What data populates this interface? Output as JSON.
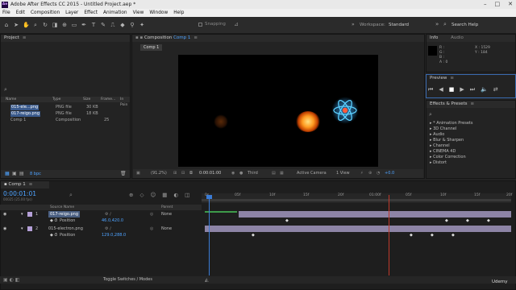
{
  "window": {
    "title": "Adobe After Effects CC 2015 - Untitled Project.aep *",
    "app_badge": "Ae",
    "minimize": "–",
    "maximize": "□",
    "close": "✕"
  },
  "menu": [
    "File",
    "Edit",
    "Composition",
    "Layer",
    "Effect",
    "Animation",
    "View",
    "Window",
    "Help"
  ],
  "toolbar": {
    "snapping": "Snapping",
    "workspace_label": "Workspace:",
    "workspace_value": "Standard",
    "search_help": "Search Help"
  },
  "project": {
    "tab": "Project",
    "tab_menu": "≡",
    "columns": [
      "Name",
      "Type",
      "Size",
      "Frame...",
      "In Poin"
    ],
    "rows": [
      {
        "name": "015-ele...png",
        "type": "PNG file",
        "size": "30 KB"
      },
      {
        "name": "017-reigo.png",
        "type": "PNG file",
        "size": "18 KB"
      },
      {
        "name": "Comp 1",
        "type": "Composition",
        "size": "",
        "frame": "25"
      }
    ],
    "bpc": "8 bpc"
  },
  "composition": {
    "tab": "Composition",
    "tab_name": "Comp 1",
    "tab_menu": "≡",
    "sub_tab": "Comp 1"
  },
  "viewer_bar": {
    "zoom": "(91.2%)",
    "timecode": "0:00:01:00",
    "view": "Third",
    "camera": "Active Camera",
    "views": "1 View",
    "exposure": "+0.0"
  },
  "info": {
    "tab": "Info",
    "tab2": "Audio",
    "r": "R :",
    "g": "G :",
    "b": "B :",
    "a": "A : 0",
    "x": "X : 1529",
    "y": "Y : 184"
  },
  "preview": {
    "tab": "Preview",
    "tab_menu": "≡"
  },
  "effects": {
    "tab": "Effects & Presets",
    "tab_menu": "≡",
    "search_icon": "⌕",
    "items": [
      "* Animation Presets",
      "3D Channel",
      "Audio",
      "Blur & Sharpen",
      "Channel",
      "CINEMA 4D",
      "Color Correction",
      "Distort"
    ]
  },
  "timeline": {
    "tab": "Comp 1",
    "tab_menu": "≡",
    "timecode": "0:00:01:01",
    "fps_sub": "00025 (25.00 fps)",
    "columns": {
      "source": "Source Name",
      "parent": "Parent"
    },
    "ruler": [
      "0s",
      "05f",
      "10f",
      "15f",
      "20f",
      "01:00f",
      "05f",
      "10f",
      "15f",
      "20f"
    ],
    "layers": [
      {
        "num": "1",
        "name": "017-reigo.png",
        "parent": "None",
        "prop": "Position",
        "value": "46.0,420.0"
      },
      {
        "num": "2",
        "name": "015-electron.png",
        "parent": "None",
        "prop": "Position",
        "value": "129.0,288.0"
      }
    ],
    "toggle": "Toggle Switches / Modes"
  },
  "watermark": "Udemy"
}
